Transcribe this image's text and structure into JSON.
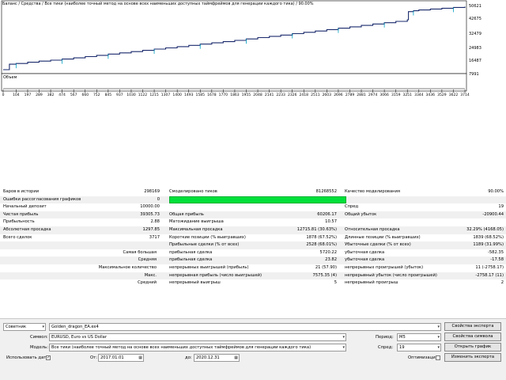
{
  "chart": {
    "title": "Баланс / Средства / Все тики (наиболее точный метод на основе всех наименьших доступных таймфреймов для генерации каждого тика) / 90.00%",
    "volume_label": "Объем",
    "y_ticks": [
      "50621",
      "42675",
      "32479",
      "24983",
      "16487",
      "7991"
    ],
    "x_ticks": [
      "0",
      "104",
      "197",
      "289",
      "382",
      "474",
      "567",
      "660",
      "752",
      "845",
      "937",
      "1030",
      "1122",
      "1215",
      "1307",
      "1400",
      "1493",
      "1585",
      "1678",
      "1770",
      "1863",
      "1955",
      "2048",
      "2141",
      "2233",
      "2326",
      "2418",
      "2511",
      "2603",
      "2696",
      "2789",
      "2881",
      "2974",
      "3066",
      "3159",
      "3251",
      "3344",
      "3436",
      "3529",
      "3622",
      "3714"
    ],
    "line_color": "#1a2a6c",
    "equity_color": "#00a0c0"
  },
  "chart_data": {
    "type": "line",
    "title": "Баланс / Средства / Все тики (наиболее точный метод на основе всех наименьших доступных таймфреймов для генерации каждого тика) / 90.00%",
    "xlabel": "",
    "ylabel": "",
    "xlim": [
      0,
      3714
    ],
    "ylim": [
      7991,
      50621
    ],
    "grid": false,
    "series": [
      {
        "name": "Баланс",
        "x": [
          0,
          50,
          104,
          197,
          289,
          382,
          474,
          567,
          660,
          752,
          845,
          937,
          1030,
          1122,
          1215,
          1307,
          1400,
          1493,
          1585,
          1678,
          1770,
          1863,
          1955,
          2048,
          2141,
          2233,
          2326,
          2418,
          2511,
          2603,
          2696,
          2789,
          2881,
          2974,
          3066,
          3159,
          3251,
          3260,
          3300,
          3344,
          3436,
          3529,
          3622,
          3714
        ],
        "y": [
          10000,
          13500,
          14000,
          14800,
          15500,
          16100,
          16800,
          17600,
          18400,
          19200,
          20000,
          20800,
          21600,
          22400,
          23200,
          24000,
          24800,
          25600,
          26400,
          27200,
          28000,
          28800,
          29700,
          30600,
          31400,
          32200,
          33100,
          34000,
          34800,
          35700,
          36600,
          37500,
          38400,
          39300,
          40100,
          41000,
          42000,
          47200,
          47800,
          48300,
          48900,
          49400,
          49900,
          50400
        ]
      }
    ]
  },
  "report": {
    "rows": [
      {
        "l1": "Баров в истории",
        "v1": "298169",
        "l2": "Смоделировано тиков",
        "v2": "81268552",
        "l3": "Качество моделирования",
        "v3": "90.00%"
      },
      {
        "l1": "Ошибки рассогласования графиков",
        "v1": "0",
        "l2": "",
        "v2": "",
        "l3": "",
        "v3": "",
        "bar": true
      },
      {
        "l1": "Начальный депозит",
        "v1": "10000.00",
        "l2": "",
        "v2": "",
        "l3": "Спред",
        "v3": "19"
      },
      {
        "l1": "Чистая прибыль",
        "v1": "39305.73",
        "l2": "Общая прибыль",
        "v2": "60206.17",
        "l3": "Общий убыток",
        "v3": "-20900.44"
      },
      {
        "l1": "Прибыльность",
        "v1": "2.88",
        "l2": "Матожидание выигрыша",
        "v2": "10.57",
        "l3": "",
        "v3": ""
      },
      {
        "l1": "Абсолютная просадка",
        "v1": "1297.85",
        "l2": "Максимальная просадка",
        "v2": "12715.81 (30.63%)",
        "l3": "Относительная просадка",
        "v3": "32.29% (4168.05)"
      },
      {
        "l1": "Всего сделок",
        "v1": "3717",
        "l2": "Короткие позиции (% выигравших)",
        "v2": "1878 (67.52%)",
        "l3": "Длинные позиции (% выигравших)",
        "v3": "1839 (68.52%)"
      },
      {
        "l1": "",
        "v1": "",
        "l2": "Прибыльные сделки (% от всех)",
        "v2": "2528 (68.01%)",
        "l3": "Убыточные сделки (% от всех)",
        "v3": "1189 (31.99%)"
      },
      {
        "rl": "Самая большая",
        "l2": "прибыльная сделка",
        "v2": "5720.22",
        "l3": "убыточная сделка",
        "v3": "-582.35"
      },
      {
        "rl": "Средняя",
        "l2": "прибыльная сделка",
        "v2": "23.82",
        "l3": "убыточная сделка",
        "v3": "-17.58"
      },
      {
        "rl": "Максимальное количество",
        "l2": "непрерывных выигрышей (прибыль)",
        "v2": "21 (57.90)",
        "l3": "непрерывных проигрышей (убыток)",
        "v3": "11 (-2758.17)"
      },
      {
        "rl": "Макс.",
        "l2": "непрерывная прибыль (число выигрышей)",
        "v2": "7575.35 (4)",
        "l3": "непрерывный убыток (число проигрышей)",
        "v3": "-2758.17 (11)"
      },
      {
        "rl": "Средний",
        "l2": "непрерывный выигрыш",
        "v2": "5",
        "l3": "непрерывный проигрыш",
        "v3": "2"
      }
    ]
  },
  "panel": {
    "type_select": "Советник",
    "expert_value": "Golden_dragon_EA.ex4",
    "symbol_label": "Символ:",
    "symbol_value": "EURUSD, Euro vs US Dollar",
    "model_label": "Модель:",
    "model_value": "Все тики (наиболее точный метод на основе всех наименьших доступных таймфреймов для генерации каждого тика)",
    "use_date_label": "Использовать дату",
    "use_date_checked": "✓",
    "from_label": "От:",
    "from_value": "2017.01.01",
    "to_label": "до:",
    "to_value": "2020.12.31",
    "period_label": "Период:",
    "period_value": "M5",
    "spread_label": "Спред:",
    "spread_value": "19",
    "optimization_label": "Оптимизация",
    "btn_expert_props": "Свойства эксперта",
    "btn_symbol_props": "Свойства символа",
    "btn_open_chart": "Открыть график",
    "btn_modify_expert": "Изменить эксперта"
  }
}
